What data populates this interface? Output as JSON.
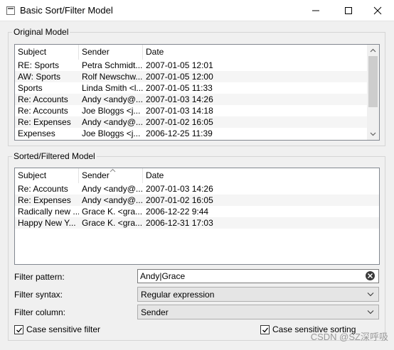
{
  "window": {
    "title": "Basic Sort/Filter Model"
  },
  "original": {
    "title": "Original Model",
    "headers": [
      "Subject",
      "Sender",
      "Date"
    ],
    "rows": [
      [
        "RE: Sports",
        "Petra Schmidt...",
        "2007-01-05 12:01"
      ],
      [
        "AW: Sports",
        "Rolf Newschw...",
        "2007-01-05 12:00"
      ],
      [
        "Sports",
        "Linda Smith <l...",
        "2007-01-05 11:33"
      ],
      [
        "Re: Accounts",
        "Andy <andy@...",
        "2007-01-03 14:26"
      ],
      [
        "Re: Accounts",
        "Joe Bloggs <j...",
        "2007-01-03 14:18"
      ],
      [
        "Re: Expenses",
        "Andy <andy@...",
        "2007-01-02 16:05"
      ],
      [
        "Expenses",
        "Joe Bloggs <j...",
        "2006-12-25 11:39"
      ]
    ]
  },
  "sorted": {
    "title": "Sorted/Filtered Model",
    "headers": [
      "Subject",
      "Sender",
      "Date"
    ],
    "rows": [
      [
        "Re: Accounts",
        "Andy <andy@...",
        "2007-01-03 14:26"
      ],
      [
        "Re: Expenses",
        "Andy <andy@...",
        "2007-01-02 16:05"
      ],
      [
        "Radically new ...",
        "Grace K. <gra...",
        "2006-12-22 9:44"
      ],
      [
        "Happy New Y...",
        "Grace K. <gra...",
        "2006-12-31 17:03"
      ]
    ]
  },
  "controls": {
    "filter_pattern_label": "Filter pattern:",
    "filter_pattern_value": "Andy|Grace",
    "filter_syntax_label": "Filter syntax:",
    "filter_syntax_value": "Regular expression",
    "filter_column_label": "Filter column:",
    "filter_column_value": "Sender",
    "case_filter_label": "Case sensitive filter",
    "case_filter_checked": true,
    "case_sort_label": "Case sensitive sorting",
    "case_sort_checked": true
  },
  "watermark": "CSDN @SZ深呼吸",
  "icons": {
    "app": "window-icon",
    "minimize": "minimize-icon",
    "maximize": "maximize-icon",
    "close": "close-icon",
    "clear": "clear-icon",
    "dropdown": "chevron-down-icon",
    "sort": "sort-indicator-icon"
  }
}
